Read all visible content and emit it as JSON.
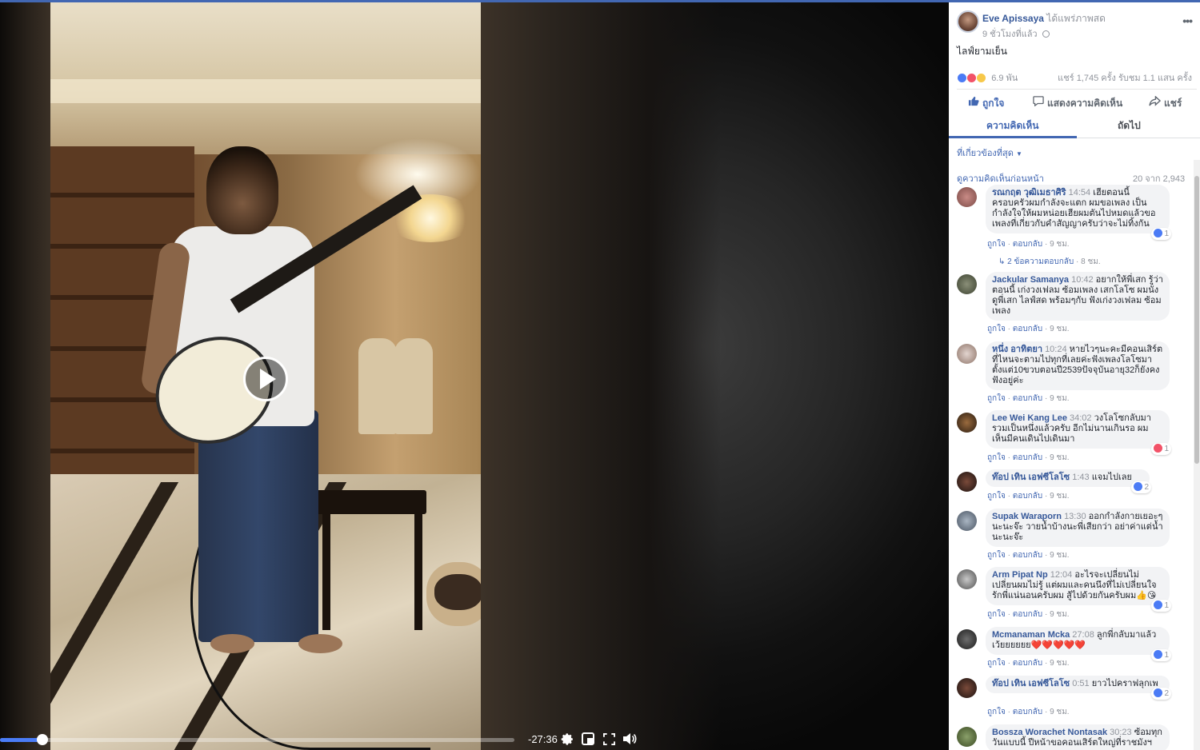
{
  "video": {
    "remaining_time": "-27:36",
    "progress_fraction": 0.075,
    "controls": [
      "gear-icon",
      "pip-icon",
      "fullscreen-icon",
      "volume-icon"
    ],
    "accent_color": "#4a7cf6"
  },
  "post": {
    "author": "Eve Apissaya",
    "action": "ได้แพร่ภาพสด",
    "time": "9 ชั่วโมงที่แล้ว",
    "text": "ไลฟ์ยามเย็น",
    "reaction_count": "6.9 พัน",
    "shares_views": "แชร์ 1,745 ครั้ง  รับชม 1.1 แสน ครั้ง",
    "actions": {
      "like": "ถูกใจ",
      "comment": "แสดงความคิดเห็น",
      "share": "แชร์"
    }
  },
  "tabs": {
    "comments": "ความคิดเห็น",
    "next": "ถัดไป"
  },
  "filter": {
    "label": "ที่เกี่ยวข้องที่สุด"
  },
  "pagination": {
    "previous": "ดูความคิดเห็นก่อนหน้า",
    "count": "20 จาก 2,943"
  },
  "labels": {
    "like": "ถูกใจ",
    "reply": "ตอบกลับ",
    "sep": "·"
  },
  "comments": [
    {
      "name": "รณกฤต วุฒิเมธาศิริ",
      "time": "14:54",
      "text": "เฮียตอนนี้ครอบครัวผมกำลังจะแตก ผมขอเพลง เป็นกำลังใจให้ผมหน่อยเฮียผมตันไปหมดแล้วขอเพลงที่เกี่ยวกับคำสัญญาครับว่าจะไม่ทิ้งกัน",
      "meta": "9 ชม.",
      "reaction": "1",
      "reaction_type": "like",
      "replies": "2 ข้อความตอบกลับ",
      "replies_time": "8 ชม."
    },
    {
      "name": "Jackular Samanya",
      "time": "10:42",
      "text": "อยากให้พี่เสก รู้ว่าตอนนี้ เก่งวงเฟลม ซ้อมเพลง เสกโลโซ ผมนั่ง ดูพี่เสก ไลฟ์สด พร้อมๆกับ ฟังเก่งวงเฟลม ซ้อมเพลง",
      "meta": "9 ชม."
    },
    {
      "name": "หนึ่ง อาทิตยา",
      "time": "10:24",
      "text": "หายไวๆนะคะมีคอนเสิร์ตที่ไหนจะตามไปทุกที่เลยค่ะฟังเพลงโลโซมาตั้งแต่10ขวบตอนปี2539ปัจจุบันอายุ32ก็ยังคงฟังอยู่ค่ะ",
      "meta": "9 ชม."
    },
    {
      "name": "Lee Wei Kang Lee",
      "time": "34:02",
      "text": "วงโลโซกลับมารวมเป็นหนึ่งแล้วครับ อีกไม่นานเกินรอ ผมเห็นมีคนเดินไปเดินมา",
      "meta": "9 ชม.",
      "reaction": "1",
      "reaction_type": "love"
    },
    {
      "name": "ท๊อป เทิน เอฟซีโลโซ",
      "time": "1:43",
      "text": "แจมไปเลย",
      "meta": "9 ชม.",
      "reaction": "2",
      "reaction_type": "like"
    },
    {
      "name": "Supak Waraporn",
      "time": "13:30",
      "text": "ออกกำลังกายเยอะๆนะนะจ๊ะ วายน้ำบ้างนะพี่เสียกว่า อย่าค่าแต่น้ำนะนะจ๊ะ",
      "meta": "9 ชม."
    },
    {
      "name": "Arm Pipat Np",
      "time": "12:04",
      "text": "อะไรจะเปลี่ยนไม่เปลี่ยนผมไม่รู้ แต่ผมและคนนึงที่ไม่เปลี่ยนใจรักพี่แน่นอนครับผม สู้ไปด้วยกันครับผม👍😘",
      "meta": "9 ชม.",
      "reaction": "1",
      "reaction_type": "like"
    },
    {
      "name": "Mcmanaman Mcka",
      "time": "27:08",
      "text": "ลูกพี่กลับมาแล้วเว้ยยยยยย❤️❤️❤️❤️❤️",
      "meta": "9 ชม.",
      "reaction": "1",
      "reaction_type": "like"
    },
    {
      "name": "ท๊อป เทิน เอฟซีโลโซ",
      "time": "0:51",
      "text": "ยาวไปคราฟลุกเพ",
      "meta": "9 ชม.",
      "reaction": "2",
      "reaction_type": "like"
    },
    {
      "name": "Bossza Worachet Nontasak",
      "time": "30:23",
      "text": "ซ้อมทุกวันแบบนี้ ปีหน้าขอคอนเสิร์ตใหญ่ที่ราชมังฯ",
      "meta": ""
    }
  ]
}
